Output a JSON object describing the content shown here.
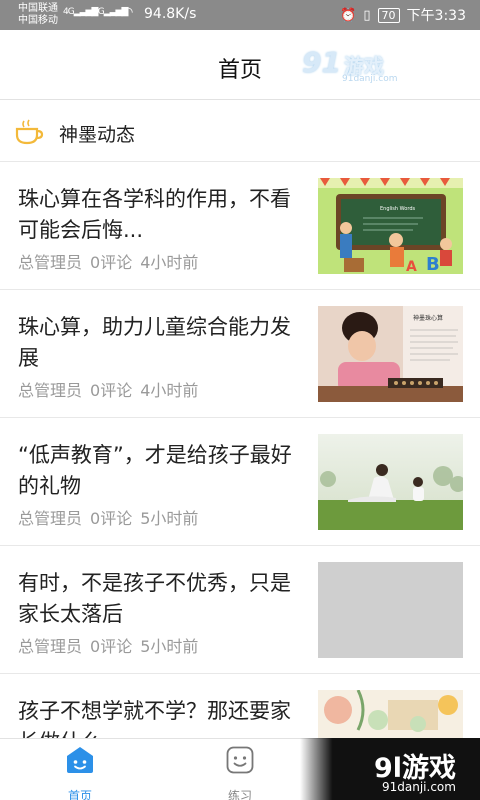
{
  "status_bar": {
    "carrier1": "中国联通",
    "carrier2": "中国移动",
    "sig1_type": "4G",
    "sig2_type": "2G",
    "net_speed": "94.8K/s",
    "battery": "70",
    "time": "下午3:33"
  },
  "header": {
    "title": "首页",
    "watermark_brand": "91游戏",
    "watermark_url": "91danji.com"
  },
  "section": {
    "icon": "coffee-cup-icon",
    "title": "神墨动态"
  },
  "news": [
    {
      "title": "珠心算在各学科的作用，不看可能会后悔...",
      "author": "总管理员",
      "comments": "0评论",
      "time": "4小时前",
      "thumb": "classroom-cartoon"
    },
    {
      "title": "珠心算，助力儿童综合能力发展",
      "author": "总管理员",
      "comments": "0评论",
      "time": "4小时前",
      "thumb": "girl-abacus"
    },
    {
      "title": "“低声教育”，才是给孩子最好的礼物",
      "author": "总管理员",
      "comments": "0评论",
      "time": "5小时前",
      "thumb": "mother-child-grass"
    },
    {
      "title": "有时，不是孩子不优秀，只是家长太落后",
      "author": "总管理员",
      "comments": "0评论",
      "time": "5小时前",
      "thumb": "placeholder"
    },
    {
      "title": "孩子不想学就不学？那还要家长做什么",
      "author": "",
      "comments": "",
      "time": "",
      "thumb": "illustration"
    }
  ],
  "thumb_texts": {
    "board": "English Words",
    "abacus_title": "神墨珠心算"
  },
  "tabbar": {
    "home_label": "首页",
    "practice_label": "练习",
    "active_color": "#2c90e8"
  },
  "bottom_watermark": {
    "brand": "9l游戏",
    "url": "91danji.com"
  }
}
